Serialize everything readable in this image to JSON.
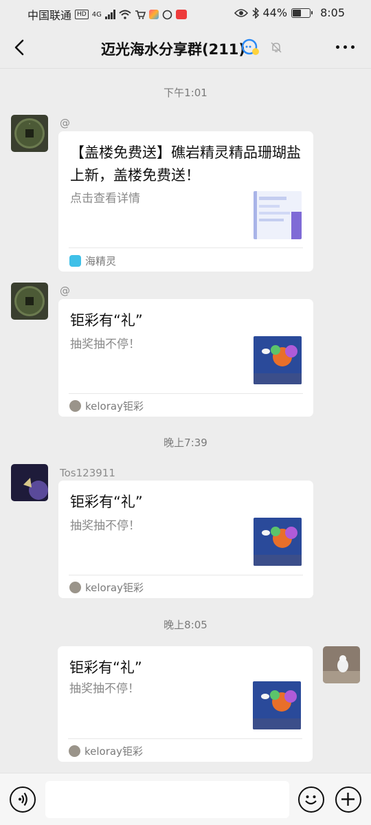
{
  "status_bar": {
    "carrier": "中国联通",
    "hd": "HD",
    "network": "4G",
    "battery": "44%",
    "battery_level": 0.44,
    "time": "8:05"
  },
  "header": {
    "title": "迈光海水分享群(211)"
  },
  "messages": [
    {
      "time": "下午1:01",
      "sender": "@",
      "card_title": "【盖楼免费送】礁岩精灵精品珊瑚盐上新，盖楼免费送！",
      "card_desc": "点击查看详情",
      "source": "海精灵"
    },
    {
      "sender": "@",
      "card_title": "钜彩有“礼”",
      "card_desc": "抽奖抽不停！",
      "source": "keloray钜彩"
    },
    {
      "time": "晚上7:39",
      "sender": "Tos123911",
      "card_title": "钜彩有“礼”",
      "card_desc": "抽奖抽不停！",
      "source": "keloray钜彩"
    },
    {
      "time": "晚上8:05",
      "card_title": "钜彩有“礼”",
      "card_desc": "抽奖抽不停！",
      "source": "keloray钜彩"
    }
  ],
  "input": {
    "placeholder": ""
  },
  "colors": {
    "background": "#ededed",
    "card": "#ffffff",
    "muted_text": "#8a8a8a",
    "wechat_green": "#07c160"
  },
  "icons": [
    "back-icon",
    "group-bubble-icon",
    "mute-bell-icon",
    "more-icon",
    "voice-icon",
    "emoji-icon",
    "plus-icon"
  ]
}
